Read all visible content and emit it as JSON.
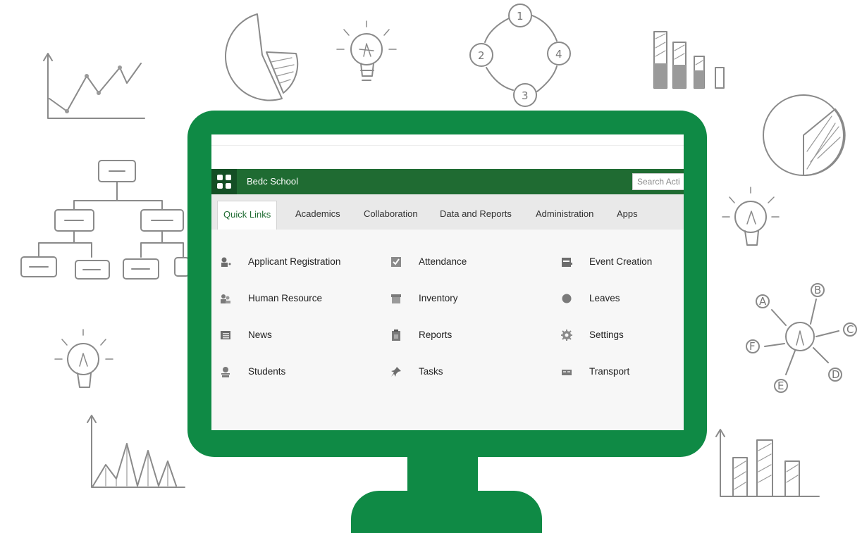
{
  "app": {
    "title": "Bedc School",
    "search_placeholder": "Search Acti"
  },
  "tabs": [
    {
      "label": "Quick Links",
      "active": true
    },
    {
      "label": "Academics",
      "active": false
    },
    {
      "label": "Collaboration",
      "active": false
    },
    {
      "label": "Data and Reports",
      "active": false
    },
    {
      "label": "Administration",
      "active": false
    },
    {
      "label": "Apps",
      "active": false
    }
  ],
  "quick_links": [
    {
      "label": "Applicant Registration",
      "icon": "applicant-icon"
    },
    {
      "label": "Attendance",
      "icon": "checkbox-icon"
    },
    {
      "label": "Event Creation",
      "icon": "calendar-icon"
    },
    {
      "label": "Human Resource",
      "icon": "people-icon"
    },
    {
      "label": "Inventory",
      "icon": "box-icon"
    },
    {
      "label": "Leaves",
      "icon": "leaf-icon"
    },
    {
      "label": "News",
      "icon": "news-icon"
    },
    {
      "label": "Reports",
      "icon": "clipboard-icon"
    },
    {
      "label": "Settings",
      "icon": "gear-icon"
    },
    {
      "label": "Students",
      "icon": "student-icon"
    },
    {
      "label": "Tasks",
      "icon": "pin-icon"
    },
    {
      "label": "Transport",
      "icon": "bus-icon"
    }
  ],
  "colors": {
    "monitor": "#0f8a45",
    "app_bar": "#1f6b32",
    "active_tab_text": "#1f6b32"
  },
  "doodle_labels": {
    "cycle": [
      "1",
      "2",
      "3",
      "4"
    ],
    "mindmap": [
      "A",
      "B",
      "C",
      "D",
      "E",
      "F"
    ]
  }
}
